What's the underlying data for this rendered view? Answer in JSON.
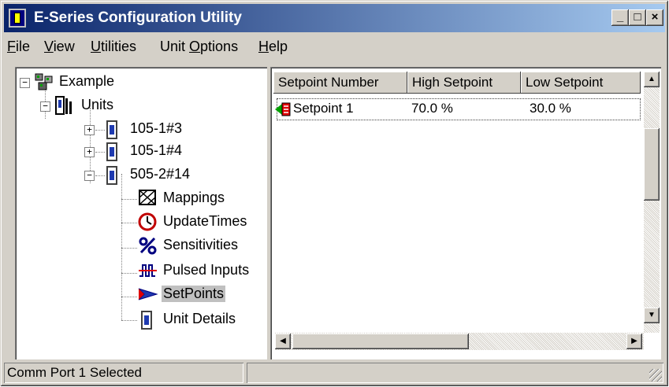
{
  "window": {
    "title": "E-Series Configuration Utility",
    "buttons": {
      "minimize": "_",
      "maximize": "□",
      "close": "×"
    }
  },
  "menubar": [
    {
      "label": "File",
      "accel": "F",
      "rest": "ile"
    },
    {
      "label": "View",
      "accel": "V",
      "rest": "iew"
    },
    {
      "label": "Utilities",
      "accel": "U",
      "rest": "tilities"
    },
    {
      "label": "Unit Options",
      "pre": "Unit ",
      "accel": "O",
      "rest": "ptions"
    },
    {
      "label": "Help",
      "accel": "H",
      "rest": "elp"
    }
  ],
  "tree": {
    "root": {
      "label": "Example",
      "icon": "network-icon",
      "expander": "−"
    },
    "units": {
      "label": "Units",
      "icon": "units-icon",
      "expander": "−"
    },
    "unit_a": {
      "label": "105-1#3",
      "icon": "unit-icon",
      "expander": "+"
    },
    "unit_b": {
      "label": "105-1#4",
      "icon": "unit-icon",
      "expander": "+"
    },
    "unit_c": {
      "label": "505-2#14",
      "icon": "unit-icon",
      "expander": "−"
    },
    "children": {
      "mappings": {
        "label": "Mappings",
        "icon": "mappings-icon"
      },
      "updatetimes": {
        "label": "UpdateTimes",
        "icon": "clock-icon"
      },
      "sensitivities": {
        "label": "Sensitivities",
        "icon": "percent-icon"
      },
      "pulsed": {
        "label": "Pulsed Inputs",
        "icon": "pulse-icon"
      },
      "setpoints": {
        "label": "SetPoints",
        "icon": "arrow-icon",
        "selected": true
      },
      "details": {
        "label": "Unit Details",
        "icon": "unit-icon"
      }
    }
  },
  "list": {
    "columns": [
      "Setpoint Number",
      "High Setpoint",
      "Low Setpoint"
    ],
    "rows": [
      {
        "name": "Setpoint 1",
        "high": "70.0 %",
        "low": "30.0 %"
      }
    ]
  },
  "statusbar": {
    "text": "Comm Port 1 Selected"
  },
  "colors": {
    "title_start": "#0a246a",
    "title_end": "#a6caf0",
    "face": "#d4d0c8"
  }
}
